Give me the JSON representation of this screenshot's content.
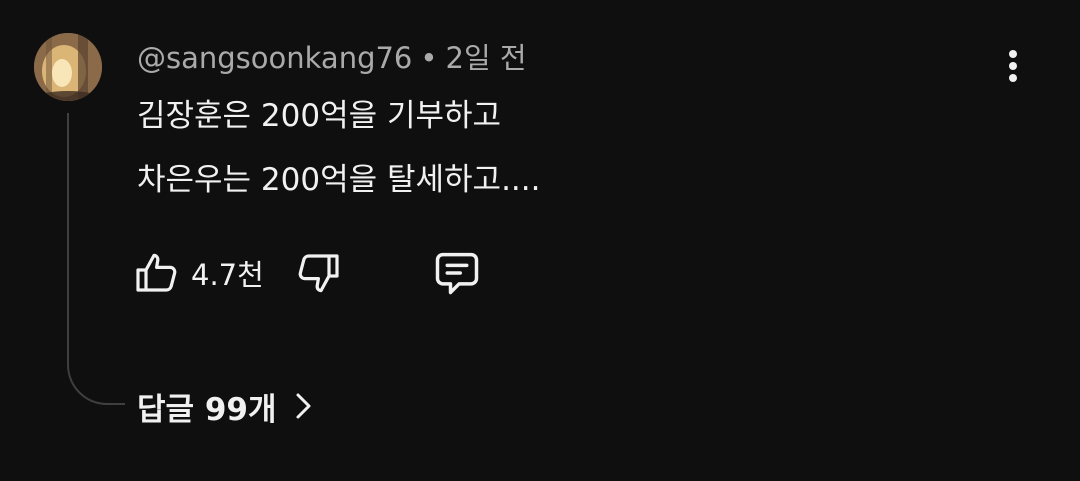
{
  "comment": {
    "author": "@sangsoonkang76",
    "separator": "•",
    "time": "2일 전",
    "lines": [
      "김장훈은 200억을 기부하고",
      "차은우는 200억을 탈세하고...."
    ],
    "like_count": "4.7천",
    "replies_label": "답글 99개"
  },
  "icons": {
    "like": "thumbs-up-icon",
    "dislike": "thumbs-down-icon",
    "reply": "comment-icon",
    "menu": "more-vert-icon",
    "replies_chevron": "chevron-right-icon"
  },
  "colors": {
    "background": "#0f0f0f",
    "text_primary": "#f1f1f1",
    "text_secondary": "#aaaaaa",
    "thread_line": "#3f3f3f"
  }
}
